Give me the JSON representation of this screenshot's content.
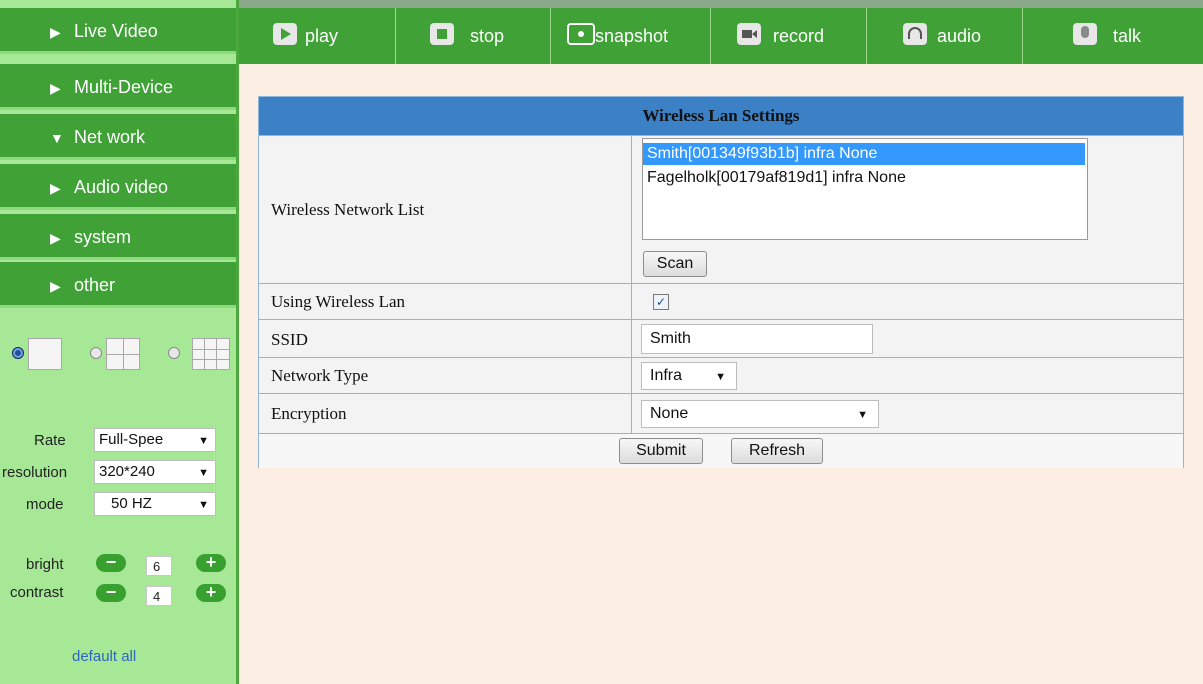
{
  "sidebar": {
    "items": [
      {
        "label": "Live Video",
        "arrow": "▶"
      },
      {
        "label": "Multi-Device",
        "arrow": "▶"
      },
      {
        "label": "Net work",
        "arrow": "▼"
      },
      {
        "label": "Audio video",
        "arrow": "▶"
      },
      {
        "label": "system",
        "arrow": "▶"
      },
      {
        "label": "other",
        "arrow": "▶"
      }
    ],
    "controls": {
      "rate": {
        "label": "Rate",
        "value": "Full-Spee"
      },
      "resolution": {
        "label": "resolution",
        "value": "320*240"
      },
      "mode": {
        "label": "mode",
        "value": "50 HZ"
      },
      "bright": {
        "label": "bright",
        "value": "6",
        "minus": "−",
        "plus": "+"
      },
      "contrast": {
        "label": "contrast",
        "value": "4",
        "minus": "−",
        "plus": "+"
      }
    },
    "default_all": "default all",
    "caret": "▼"
  },
  "toolbar": {
    "play": "play",
    "stop": "stop",
    "snapshot": "snapshot",
    "record": "record",
    "audio": "audio",
    "talk": "talk"
  },
  "settings": {
    "title": "Wireless Lan Settings",
    "network_list_label": "Wireless Network List",
    "networks": [
      "Smith[001349f93b1b] infra None",
      "Fagelholk[00179af819d1] infra None"
    ],
    "selected_index": 0,
    "scan": "Scan",
    "using_label": "Using Wireless Lan",
    "using_checked": "✓",
    "ssid_label": "SSID",
    "ssid_value": "Smith",
    "network_type_label": "Network Type",
    "network_type_value": "Infra",
    "encryption_label": "Encryption",
    "encryption_value": "None",
    "submit": "Submit",
    "refresh": "Refresh",
    "caret": "▼"
  },
  "colors": {
    "sidebar_green": "#3fa136",
    "sidebar_bg": "#a7e896",
    "header_blue": "#3c80c5",
    "selection_blue": "#3399ff",
    "page_bg": "#fdeee3"
  }
}
